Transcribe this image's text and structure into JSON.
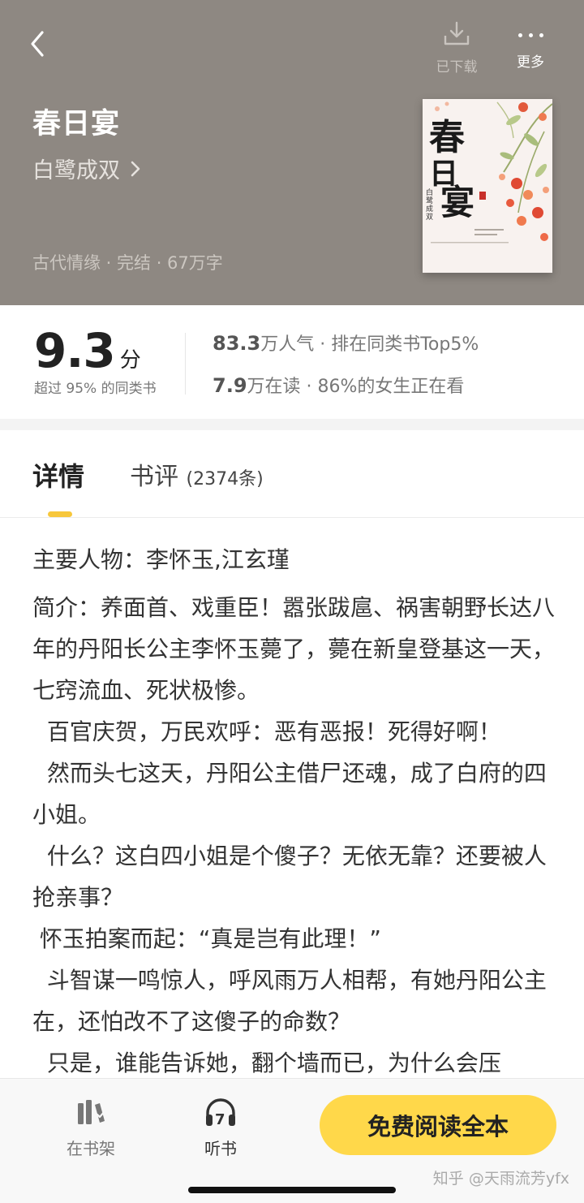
{
  "header": {
    "download_label": "已下载",
    "more_label": "更多",
    "book_title": "春日宴",
    "author": "白鹭成双",
    "meta": "古代情缘 · 完结 · 67万字",
    "cover_title": "春日宴",
    "cover_author": "白鹭成双"
  },
  "rating": {
    "score": "9.3",
    "score_unit": "分",
    "score_desc": "超过 95% 的同类书",
    "popularity_value": "83.3",
    "popularity_text": "万人气 · 排在同类书Top5%",
    "readers_value": "7.9",
    "readers_text": "万在读 · 86%的女生正在看"
  },
  "tabs": {
    "detail": "详情",
    "review": "书评",
    "review_count": "(2374条)"
  },
  "content": {
    "characters": "主要人物：李怀玉,江玄瑾",
    "paragraphs": [
      "简介：养面首、戏重臣！嚣张跋扈、祸害朝野长达八年的丹阳长公主李怀玉薨了，薨在新皇登基这一天，七窍流血、死状极惨。",
      "  百官庆贺，万民欢呼：恶有恶报！死得好啊！",
      "  然而头七这天，丹阳公主借尸还魂，成了白府的四小姐。",
      "  什么？这白四小姐是个傻子？无依无靠？还要被人抢亲事？",
      " 怀玉拍案而起：“真是岂有此理！”",
      "  斗智谋一鸣惊人，呼风雨万人相帮，有她丹阳公主在，还怕改不了这傻子的命数？",
      "  只是，谁能告诉她，翻个墙而已，为什么会压"
    ]
  },
  "bottom": {
    "shelf_label": "在书架",
    "listen_label": "听书",
    "read_label": "免费阅读全本",
    "watermark": "知乎 @天雨流芳yfx"
  },
  "colors": {
    "header_bg": "#8e8882",
    "accent_yellow": "#ffd84a",
    "tab_indicator": "#f7c73b"
  }
}
